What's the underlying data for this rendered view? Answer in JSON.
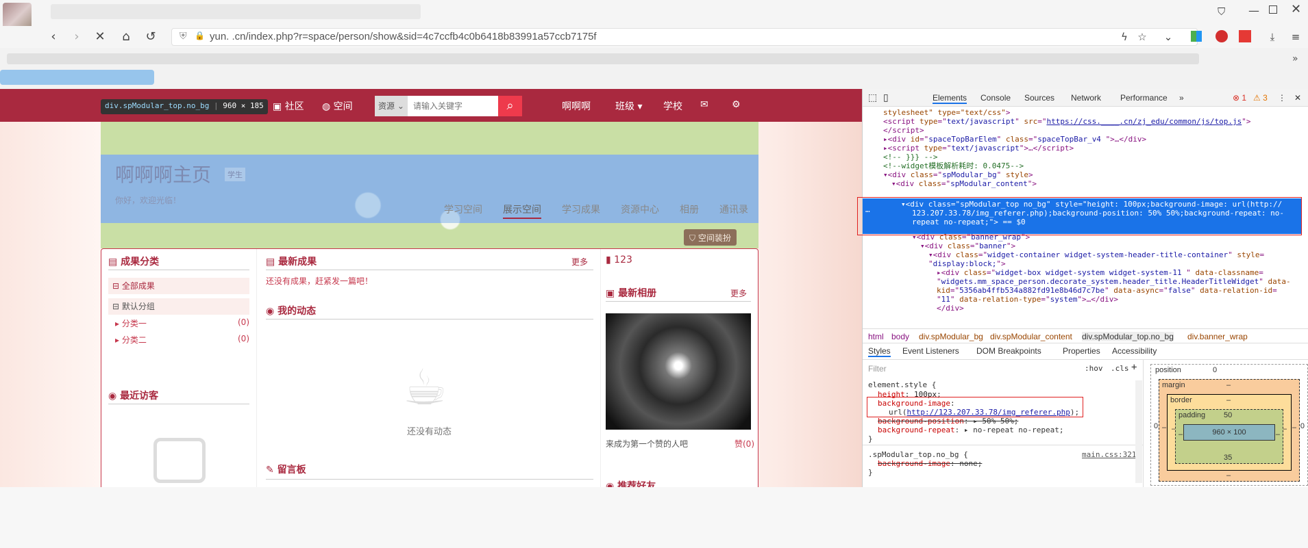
{
  "browser": {
    "url": "yun.  .cn/index.php?r=space/person/show&sid=4c7ccfb4c0b6418b83991a57ccb7175f"
  },
  "topbar": {
    "element_tooltip_name": "div.spModular_top.no_bg",
    "element_tooltip_size": "960 × 185",
    "community": "社区",
    "space": "空间",
    "search_category": "资源",
    "search_placeholder": "请输入关键字",
    "user": "啊啊啊",
    "class": "班级",
    "school": "学校"
  },
  "banner": {
    "title": "啊啊啊主页",
    "role_badge": "学生",
    "greeting": "你好，欢迎光临！",
    "tabs": [
      "学习空间",
      "展示空间",
      "学习成果",
      "资源中心",
      "相册",
      "通讯录"
    ],
    "decorate_button": "空间装扮"
  },
  "left_col": {
    "achievement_title": "成果分类",
    "all": "全部成果",
    "default_group": "默认分组",
    "categories": [
      {
        "name": "分类一",
        "count": "(0)"
      },
      {
        "name": "分类二",
        "count": "(0)"
      }
    ],
    "visitors_title": "最近访客"
  },
  "mid_col": {
    "latest_title": "最新成果",
    "more": "更多",
    "empty_msg": "还没有成果，赶紧发一篇吧！",
    "dynamics_title": "我的动态",
    "no_dynamics": "还没有动态",
    "guestbook_title": "留言板"
  },
  "right_col": {
    "name": "123",
    "album_title": "最新相册",
    "more": "更多",
    "like_prompt": "来成为第一个赞的人吧",
    "like": "赞(0)",
    "friends_title": "推荐好友"
  },
  "devtools": {
    "tabs": [
      "Elements",
      "Console",
      "Sources",
      "Network",
      "Performance"
    ],
    "error_count": "1",
    "warn_count": "3",
    "breadcrumbs": [
      "html",
      "body",
      "div.spModular_bg",
      "div.spModular_content",
      "div.spModular_top.no_bg",
      "div.banner_wrap"
    ],
    "subtabs": [
      "Styles",
      "Event Listeners",
      "DOM Breakpoints",
      "Properties",
      "Accessibility"
    ],
    "filter_placeholder": "Filter",
    "hov": ":hov",
    "cls": ".cls",
    "box_position_label": "position",
    "box_position_val": "0",
    "box_margin_label": "margin",
    "box_border_label": "border",
    "box_padding_label": "padding",
    "box_padding_top": "50",
    "box_padding_bottom": "35",
    "box_content": "960 × 100",
    "box_dash": "–",
    "box_zero": "0",
    "main_css": "main.css:321"
  }
}
